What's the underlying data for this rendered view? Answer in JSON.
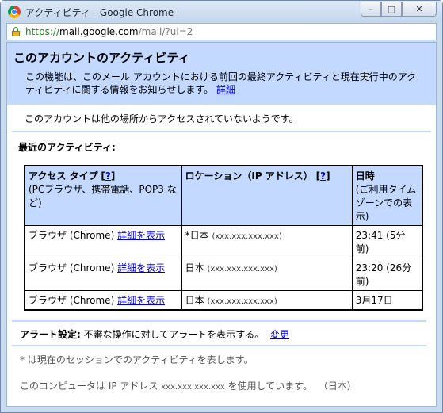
{
  "window": {
    "title": "アクティビティ - Google Chrome",
    "buttons": {
      "minimize": "–",
      "maximize": "□",
      "close": "✕"
    }
  },
  "urlbar": {
    "scheme": "https://",
    "host": "mail.google.com",
    "path": "/mail/?ui=2"
  },
  "header": {
    "title": "このアカウントのアクティビティ",
    "description": "この機能は、このメール アカウントにおける前回の最終アクティビティと現在実行中のアクティビティに関する情報をお知らせします。",
    "details_link": "詳細"
  },
  "status_text": "このアカウントは他の場所からアクセスされていないようです。",
  "recent_title": "最近のアクティビティ:",
  "table": {
    "headers": [
      {
        "title": "アクセス タイプ",
        "help": "?",
        "sub": "(PCブラウザ、携帯電話、POP3 など)"
      },
      {
        "title": "ロケーション（IP アドレス）",
        "help": "?",
        "sub": ""
      },
      {
        "title": "日時",
        "help": "",
        "sub": "(ご利用タイム ゾーンでの表示)"
      }
    ],
    "rows": [
      {
        "type": "ブラウザ (Chrome)",
        "link": "詳細を表示",
        "location": "*日本",
        "ip": "(xxx.xxx.xxx.xxx)",
        "time": "23:41 (5分前)"
      },
      {
        "type": "ブラウザ (Chrome)",
        "link": "詳細を表示",
        "location": "日本",
        "ip": "(xxx.xxx.xxx.xxx)",
        "time": "23:20 (26分前)"
      },
      {
        "type": "ブラウザ (Chrome)",
        "link": "詳細を表示",
        "location": "日本",
        "ip": "(xxx.xxx.xxx.xxx)",
        "time": "3月17日"
      }
    ]
  },
  "alert": {
    "label": "アラート設定:",
    "text": "不審な操作に対してアラートを表示する。",
    "change_link": "変更"
  },
  "footer": {
    "note": "* は現在のセッションでのアクティビティを表します。",
    "computer_prefix": "このコンピュータは IP アドレス",
    "computer_ip": "xxx.xxx.xxx.xxx",
    "computer_suffix": "を使用しています。",
    "computer_country": "（日本）"
  }
}
